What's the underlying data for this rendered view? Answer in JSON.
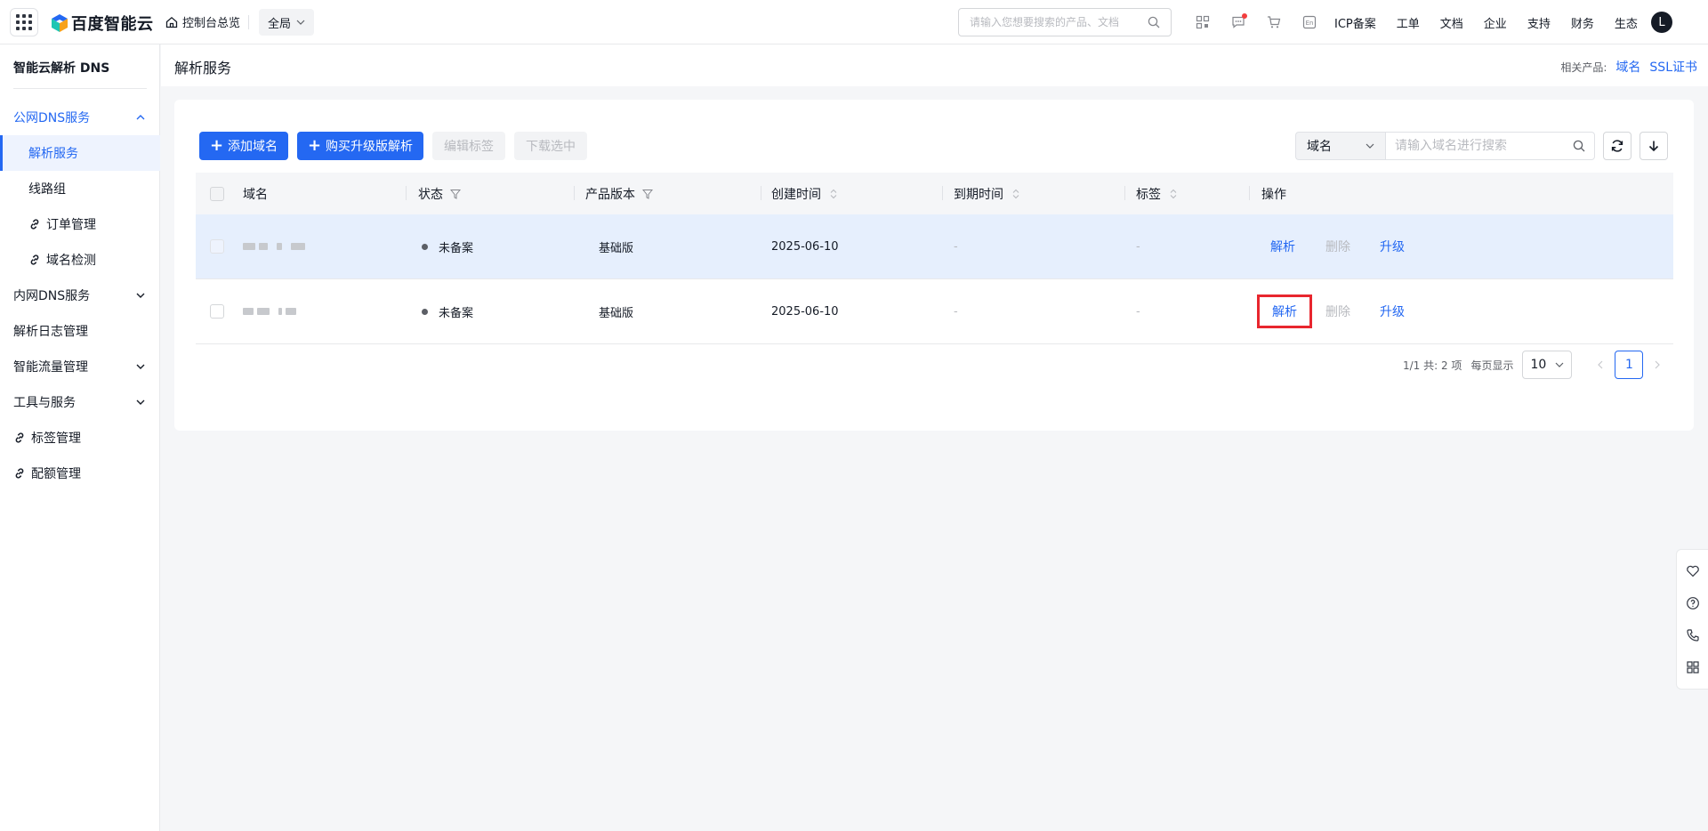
{
  "topbar": {
    "brand": "百度智能云",
    "console_home": "控制台总览",
    "scope": "全局",
    "search_placeholder": "请输入您想要搜索的产品、文档",
    "icons": [
      "qrcode-icon",
      "message-icon",
      "cart-icon",
      "language-icon"
    ],
    "language_label": "En",
    "links": [
      "ICP备案",
      "工单",
      "文档",
      "企业",
      "支持",
      "财务",
      "生态"
    ],
    "avatar_letter": "L"
  },
  "sidebar": {
    "title": "智能云解析 DNS",
    "items": [
      {
        "label": "公网DNS服务",
        "type": "group-open"
      },
      {
        "label": "解析服务",
        "type": "active-sub"
      },
      {
        "label": "线路组",
        "type": "sub"
      },
      {
        "label": "订单管理",
        "type": "sub-link"
      },
      {
        "label": "域名检测",
        "type": "sub-link"
      },
      {
        "label": "内网DNS服务",
        "type": "group"
      },
      {
        "label": "解析日志管理",
        "type": "plain"
      },
      {
        "label": "智能流量管理",
        "type": "group"
      },
      {
        "label": "工具与服务",
        "type": "group"
      },
      {
        "label": "标签管理",
        "type": "link"
      },
      {
        "label": "配额管理",
        "type": "link"
      }
    ]
  },
  "page": {
    "title": "解析服务",
    "related_label": "相关产品:",
    "related_links": [
      "域名",
      "SSL证书"
    ]
  },
  "toolbar": {
    "add_domain": "添加域名",
    "buy_upgrade": "购买升级版解析",
    "edit_tags": "编辑标签",
    "download_selected": "下载选中",
    "filter_field": "域名",
    "search_placeholder": "请输入域名进行搜索"
  },
  "table": {
    "columns": [
      "域名",
      "状态",
      "产品版本",
      "创建时间",
      "到期时间",
      "标签",
      "操作"
    ],
    "rows": [
      {
        "status": "未备案",
        "version": "基础版",
        "created": "2025-06-10",
        "expires": "-",
        "tags": "-",
        "ops": [
          "解析",
          "删除",
          "升级"
        ]
      },
      {
        "status": "未备案",
        "version": "基础版",
        "created": "2025-06-10",
        "expires": "-",
        "tags": "-",
        "ops": [
          "解析",
          "删除",
          "升级"
        ]
      }
    ]
  },
  "pagination": {
    "summary": "1/1 共: 2 项",
    "per_page_label": "每页显示",
    "page_size": "10",
    "current_page": "1"
  },
  "colors": {
    "primary": "#2468f2",
    "highlight": "#e8262e",
    "row_hover": "#e6effd"
  }
}
